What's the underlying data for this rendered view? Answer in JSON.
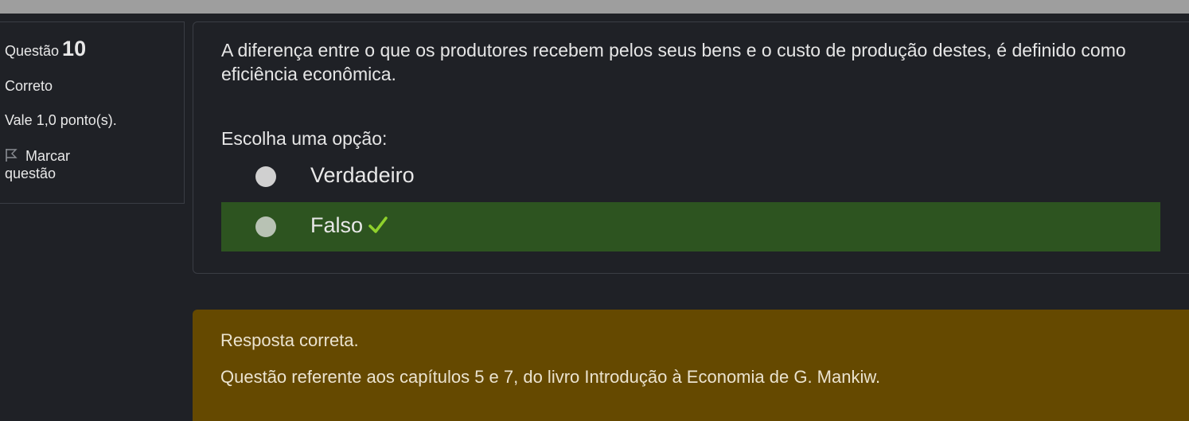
{
  "question_info": {
    "label": "Questão",
    "number": "10",
    "state": "Correto",
    "grade": "Vale 1,0 ponto(s).",
    "flag_label_line1": "Marcar",
    "flag_label_line2": "questão"
  },
  "question": {
    "text": "A diferença entre o que os produtores recebem pelos seus bens e o custo de produção destes, é definido como eficiência econômica.",
    "prompt": "Escolha uma opção:",
    "options": [
      {
        "label": "Verdadeiro",
        "correct": false
      },
      {
        "label": "Falso",
        "correct": true
      }
    ],
    "correct_icon": "checkmark-icon"
  },
  "feedback": {
    "status": "Resposta correta.",
    "detail": "Questão referente aos capítulos 5 e 7, do livro Introdução à Economia de G. Mankiw."
  },
  "colors": {
    "background": "#1f2126",
    "topbar": "#9e9e9e",
    "correct_option": "#2d5420",
    "feedback_bg": "#654900",
    "checkmark": "#8fd12c"
  }
}
